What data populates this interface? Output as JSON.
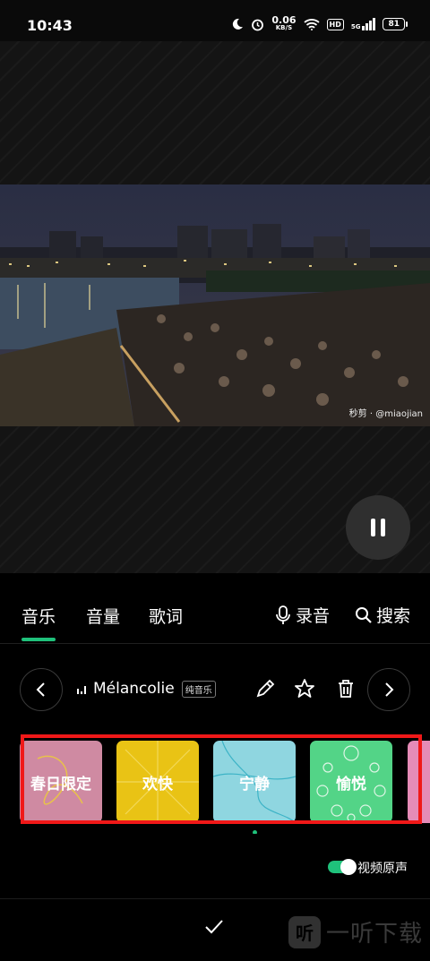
{
  "status_bar": {
    "time": "10:43",
    "net_speed_value": "0.06",
    "net_speed_unit": "KB/S",
    "hd_badge": "HD",
    "signal_label": "5G",
    "battery": "81"
  },
  "video": {
    "watermark": "秒剪 · @miaojian"
  },
  "tabs": [
    {
      "label": "音乐",
      "active": true
    },
    {
      "label": "音量",
      "active": false
    },
    {
      "label": "歌词",
      "active": false
    }
  ],
  "actions": {
    "record_label": "录音",
    "search_label": "搜索"
  },
  "song": {
    "title": "Mélancolie",
    "tag": "纯音乐"
  },
  "moods": [
    {
      "label": "春日限定",
      "color": "#cf8aa2"
    },
    {
      "label": "欢快",
      "color": "#e9c315"
    },
    {
      "label": "宁静",
      "color": "#8fd6e0"
    },
    {
      "label": "愉悦",
      "color": "#53d487"
    }
  ],
  "original_audio": {
    "label": "视频原声",
    "enabled": true
  },
  "brand": {
    "logo_text": "听",
    "name": "一听下载"
  },
  "colors": {
    "accent": "#1fc17b",
    "highlight_box": "#f01818"
  }
}
